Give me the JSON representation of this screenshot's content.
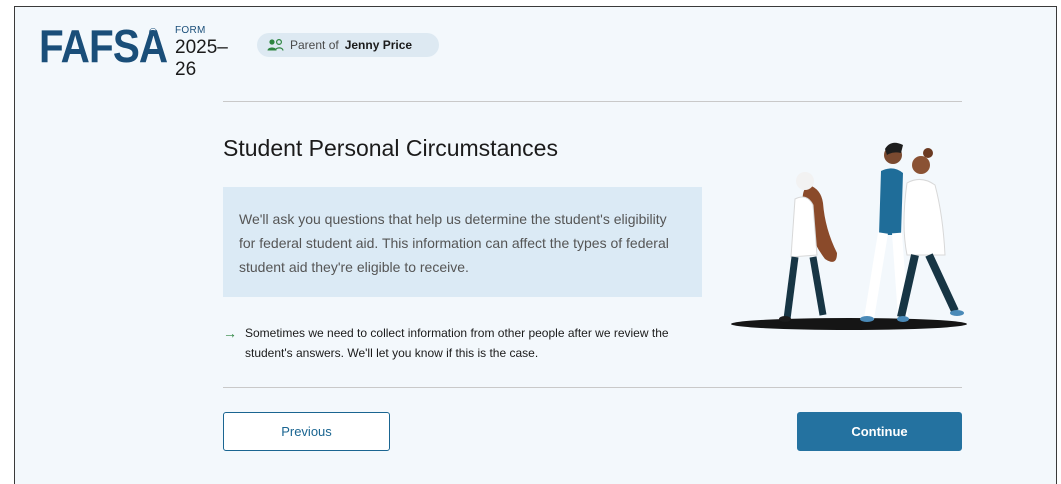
{
  "header": {
    "logo": "FAFSA",
    "logo_reg": "®",
    "form_label": "FORM",
    "form_year": "2025–26",
    "role_prefix": "Parent of",
    "role_name": "Jenny Price"
  },
  "main": {
    "title": "Student Personal Circumstances",
    "info_text": "We'll ask you questions that help us determine the student's eligibility for federal student aid. This information can affect the types of federal student aid they're eligible to receive.",
    "note_arrow": "→",
    "note_text": "Sometimes we need to collect information from other people after we review the student's answers. We'll let you know if this is the case."
  },
  "buttons": {
    "previous": "Previous",
    "continue": "Continue"
  },
  "icons": {
    "role": "users-icon",
    "note": "arrow-right-icon"
  },
  "colors": {
    "brand": "#1a4e79",
    "primary_button": "#2472a0",
    "info_background": "#dbeaf5",
    "arrow": "#2e8540"
  }
}
